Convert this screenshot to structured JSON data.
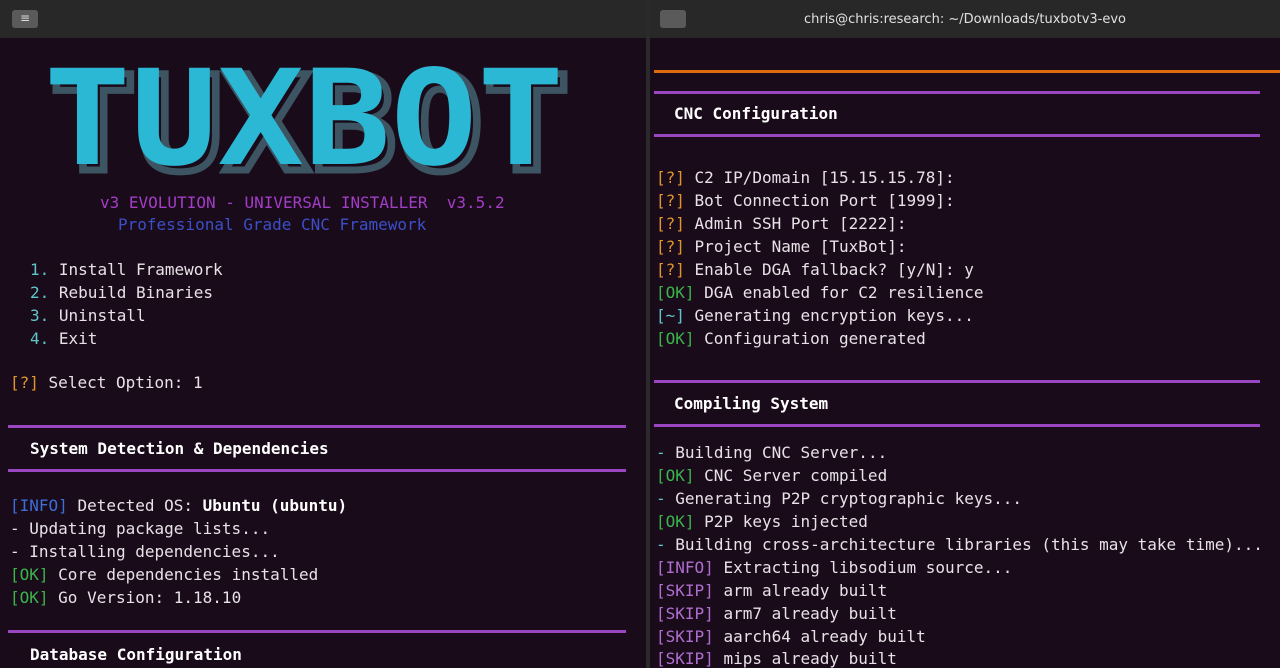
{
  "left_window": {
    "menu_icon": "≡",
    "logo_text": "TUXBOT",
    "subtitle": "v3 EVOLUTION - UNIVERSAL INSTALLER  v3.5.2",
    "tagline": "Professional Grade CNC Framework",
    "menu": [
      {
        "num": "1.",
        "label": "Install Framework"
      },
      {
        "num": "2.",
        "label": "Rebuild Binaries"
      },
      {
        "num": "3.",
        "label": "Uninstall"
      },
      {
        "num": "4.",
        "label": "Exit"
      }
    ],
    "prompt": {
      "tag": "[?]",
      "text": "Select Option: 1"
    },
    "section1": "System Detection & Dependencies",
    "detect": {
      "tag": "[INFO]",
      "text": "Detected OS: ",
      "bold": "Ubuntu (ubuntu)"
    },
    "update": "- Updating package lists...",
    "install": "- Installing dependencies...",
    "ok1": {
      "tag": "[OK]",
      "text": "Core dependencies installed"
    },
    "ok2": {
      "tag": "[OK]",
      "text": "Go Version: 1.18.10"
    },
    "section2": "Database Configuration"
  },
  "right_window": {
    "title": "chris@chris:research: ~/Downloads/tuxbotv3-evo",
    "section1": "CNC Configuration",
    "config": [
      {
        "tag": "[?]",
        "text": "C2 IP/Domain [15.15.15.78]:"
      },
      {
        "tag": "[?]",
        "text": "Bot Connection Port [1999]:"
      },
      {
        "tag": "[?]",
        "text": "Admin SSH Port [2222]:"
      },
      {
        "tag": "[?]",
        "text": "Project Name [TuxBot]:"
      },
      {
        "tag": "[?]",
        "text": "Enable DGA fallback? [y/N]: y"
      },
      {
        "tag": "[OK]",
        "text": "DGA enabled for C2 resilience"
      },
      {
        "tag": "[~]",
        "text": "Generating encryption keys..."
      },
      {
        "tag": "[OK]",
        "text": "Configuration generated"
      }
    ],
    "section2": "Compiling System",
    "compile": [
      {
        "tag": "-",
        "text": "Building CNC Server..."
      },
      {
        "tag": "[OK]",
        "text": "CNC Server compiled"
      },
      {
        "tag": "-",
        "text": "Generating P2P cryptographic keys..."
      },
      {
        "tag": "[OK]",
        "text": "P2P keys injected"
      },
      {
        "tag": "-",
        "text": "Building cross-architecture libraries (this may take time)..."
      },
      {
        "tag": "[INFO]",
        "text": "Extracting libsodium source..."
      },
      {
        "tag": "[SKIP]",
        "text": "arm already built"
      },
      {
        "tag": "[SKIP]",
        "text": "arm7 already built"
      },
      {
        "tag": "[SKIP]",
        "text": "aarch64 already built"
      },
      {
        "tag": "[SKIP]",
        "text": "mips already built"
      }
    ]
  },
  "colors": {
    "background": "#1a0b1a",
    "warn": "#e0962a",
    "ok": "#39b54a",
    "info": "#3b6ed8",
    "skip": "#b06fd0",
    "rule": "#9a46c0",
    "logo_fill": "#2bb8d4"
  }
}
